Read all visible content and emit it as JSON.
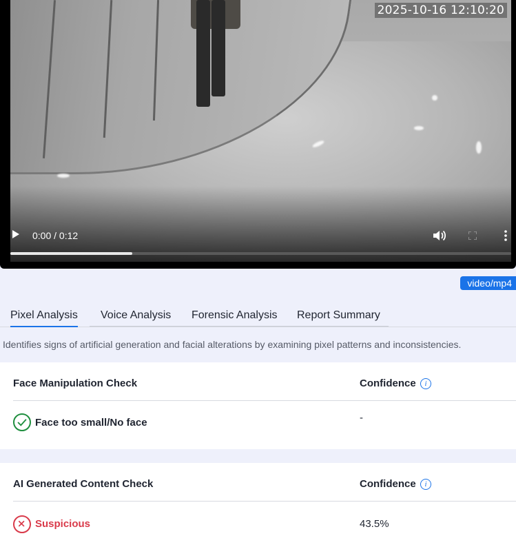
{
  "video": {
    "timestamp_overlay": "2025-10-16 12:10:20",
    "time_display": "0:00 / 0:12",
    "progress_fraction": 0.243
  },
  "format_badge": "video/mp4",
  "tabs": [
    {
      "label": "Pixel Analysis",
      "active": true
    },
    {
      "label": "Voice Analysis",
      "active": false
    },
    {
      "label": "Forensic Analysis",
      "active": false
    },
    {
      "label": "Report Summary",
      "active": false
    }
  ],
  "description": "Identifies signs of artificial generation and facial alterations by examining pixel patterns and inconsistencies.",
  "checks": [
    {
      "title": "Face Manipulation Check",
      "confidence_label": "Confidence",
      "result": "Face too small/No face",
      "status": "ok",
      "confidence_value": "-"
    },
    {
      "title": "AI Generated Content Check",
      "confidence_label": "Confidence",
      "result": "Suspicious",
      "status": "suspicious",
      "confidence_value": "43.5%"
    }
  ],
  "colors": {
    "accent": "#1a73e8",
    "ok": "#1e8e3e",
    "suspicious": "#d93a4a"
  }
}
